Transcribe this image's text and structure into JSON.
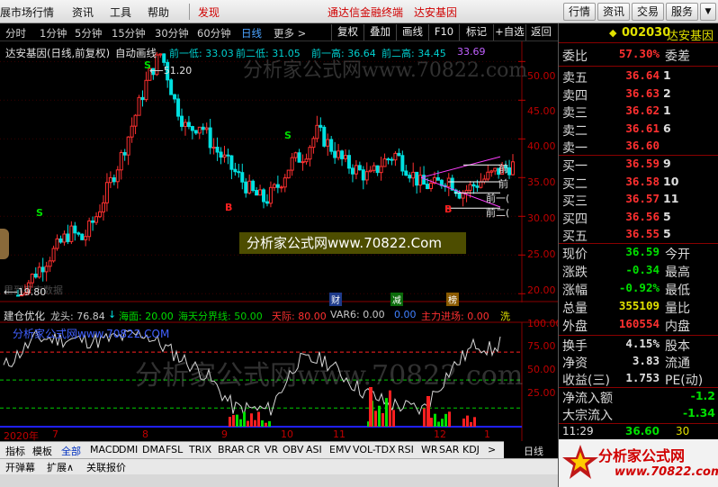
{
  "menu": {
    "items": [
      "展市场行情",
      "资讯",
      "工具",
      "帮助"
    ],
    "alert": "发现",
    "title": "通达信金融终端",
    "stock_title": "达安基因",
    "right_buttons": [
      "行情",
      "资讯",
      "交易",
      "服务"
    ]
  },
  "periods": {
    "items": [
      "分时",
      "1分钟",
      "5分钟",
      "15分钟",
      "30分钟",
      "60分钟",
      "日线",
      "更多 >"
    ],
    "active_index": 6,
    "tools": [
      "复权",
      "叠加",
      "画线",
      "F10",
      "标记",
      "+自选",
      "返回"
    ]
  },
  "chart": {
    "header_title": "达安基因(日线,前复权)",
    "header_auto": "自动画线",
    "prev_low_label": "前一低: 33.03",
    "prev_low2_label": "前二低: 31.05",
    "prev_high_label": "前一高: 36.64",
    "prev_high2_label": "前二高: 34.45",
    "extra_value": "33.69",
    "watermark_main": "分析家公式网www.70822.com",
    "watermark_ad": "分析家公式网www.70822.Com",
    "peak_label": "51.20",
    "low_label": "19.80",
    "no_data": "里到来市数据",
    "s_marks": [
      "S",
      "S",
      "S"
    ],
    "b_marks": [
      "B",
      "B"
    ],
    "line_labels": [
      "前",
      "前",
      "前一(",
      "前二("
    ],
    "event_marks": [
      "财",
      "减",
      "榜"
    ],
    "y_ticks": [
      "50.00",
      "45.00",
      "40.00",
      "35.00",
      "30.00",
      "25.00",
      "20.00"
    ]
  },
  "chart_data": {
    "type": "candlestick",
    "title": "达安基因(日线,前复权)",
    "peak": 51.2,
    "low": 19.8,
    "ylim": [
      19.8,
      51.2
    ],
    "approx_close_path": [
      19.8,
      22,
      24,
      26,
      28,
      27,
      30,
      34,
      38,
      43,
      48,
      51.2,
      45,
      41,
      42,
      39,
      37,
      35,
      33,
      32,
      34,
      37,
      38,
      41,
      39,
      37,
      36,
      35,
      37,
      38,
      36,
      34,
      34,
      35,
      33,
      34,
      35,
      36,
      36.6
    ],
    "support_lines": [
      {
        "name": "前一低",
        "value": 33.03
      },
      {
        "name": "前二低",
        "value": 31.05
      },
      {
        "name": "前一高",
        "value": 36.64
      },
      {
        "name": "前二高",
        "value": 34.45
      }
    ]
  },
  "indicator": {
    "name": "建仓优化",
    "watermark": "分析家公式网www.70822.COM",
    "labels": [
      {
        "text": "龙头: 76.84",
        "color": "#c8c8c8"
      },
      {
        "text": "海面: 20.00",
        "color": "#00e000"
      },
      {
        "text": "海天分界线: 50.00",
        "color": "#00d000"
      },
      {
        "text": "天际: 80.00",
        "color": "#ff3030"
      },
      {
        "text": "VAR6: 0.00",
        "color": "#c8c8c8"
      },
      {
        "text": "0.00",
        "color": "#4080ff"
      },
      {
        "text": "主力进场: 0.00",
        "color": "#ff3030"
      },
      {
        "text": "洗",
        "color": "#e0e000"
      }
    ],
    "y_ticks": [
      "100.00",
      "75.00",
      "50.00",
      "25.00"
    ],
    "x_labels": [
      "2020年",
      "7",
      "8",
      "9",
      "10",
      "11",
      "12",
      "1"
    ]
  },
  "bottom_tabs": {
    "items": [
      "指标",
      "模板",
      "全部",
      "MACD",
      "DMI",
      "DMA",
      "FSL",
      "TRIX",
      "BRAR",
      "CR",
      "VR",
      "OBV",
      "ASI",
      "EMV",
      "VOL-TDX",
      "RSI",
      "WR",
      "SAR",
      "KDJ",
      ">"
    ],
    "active_index": 2,
    "second_row": [
      "开弹幕",
      "扩展∧",
      "关联报价"
    ],
    "day_line": "日线"
  },
  "quote": {
    "code": "002030",
    "name": "达安基因",
    "wei_bi_label": "委比",
    "wei_bi": "57.30%",
    "wei_cha_label": "委差",
    "asks": [
      {
        "label": "卖五",
        "price": "36.64",
        "vol": "1"
      },
      {
        "label": "卖四",
        "price": "36.63",
        "vol": "2"
      },
      {
        "label": "卖三",
        "price": "36.62",
        "vol": "1"
      },
      {
        "label": "卖二",
        "price": "36.61",
        "vol": "6"
      },
      {
        "label": "卖一",
        "price": "36.60",
        "vol": ""
      }
    ],
    "bids": [
      {
        "label": "买一",
        "price": "36.59",
        "vol": "9"
      },
      {
        "label": "买二",
        "price": "36.58",
        "vol": "10"
      },
      {
        "label": "买三",
        "price": "36.57",
        "vol": "11"
      },
      {
        "label": "买四",
        "price": "36.56",
        "vol": "5"
      },
      {
        "label": "买五",
        "price": "36.55",
        "vol": "5"
      }
    ],
    "stats": [
      {
        "label": "现价",
        "value": "36.59",
        "color": "#00e000",
        "label2": "今开"
      },
      {
        "label": "涨跌",
        "value": "-0.34",
        "color": "#00e000",
        "label2": "最高"
      },
      {
        "label": "涨幅",
        "value": "-0.92%",
        "color": "#00e000",
        "label2": "最低"
      },
      {
        "label": "总量",
        "value": "355109",
        "color": "#e0e000",
        "label2": "量比"
      },
      {
        "label": "外盘",
        "value": "160554",
        "color": "#ff3030",
        "label2": "内盘"
      }
    ],
    "stats2": [
      {
        "label": "换手",
        "value": "4.15%",
        "color": "#e0e0e0",
        "label2": "股本"
      },
      {
        "label": "净资",
        "value": "3.83",
        "color": "#e0e0e0",
        "label2": "流通"
      },
      {
        "label": "收益(三)",
        "value": "1.753",
        "color": "#e0e0e0",
        "label2": "PE(动)"
      }
    ],
    "flows": [
      {
        "label": "净流入额",
        "value": "-1.2"
      },
      {
        "label": "大宗流入",
        "value": "-1.34"
      }
    ],
    "tick": {
      "time": "11:29",
      "price": "36.60",
      "vol": "30"
    },
    "brand": "分析家公式网",
    "brand_url": "www.70822.com"
  }
}
